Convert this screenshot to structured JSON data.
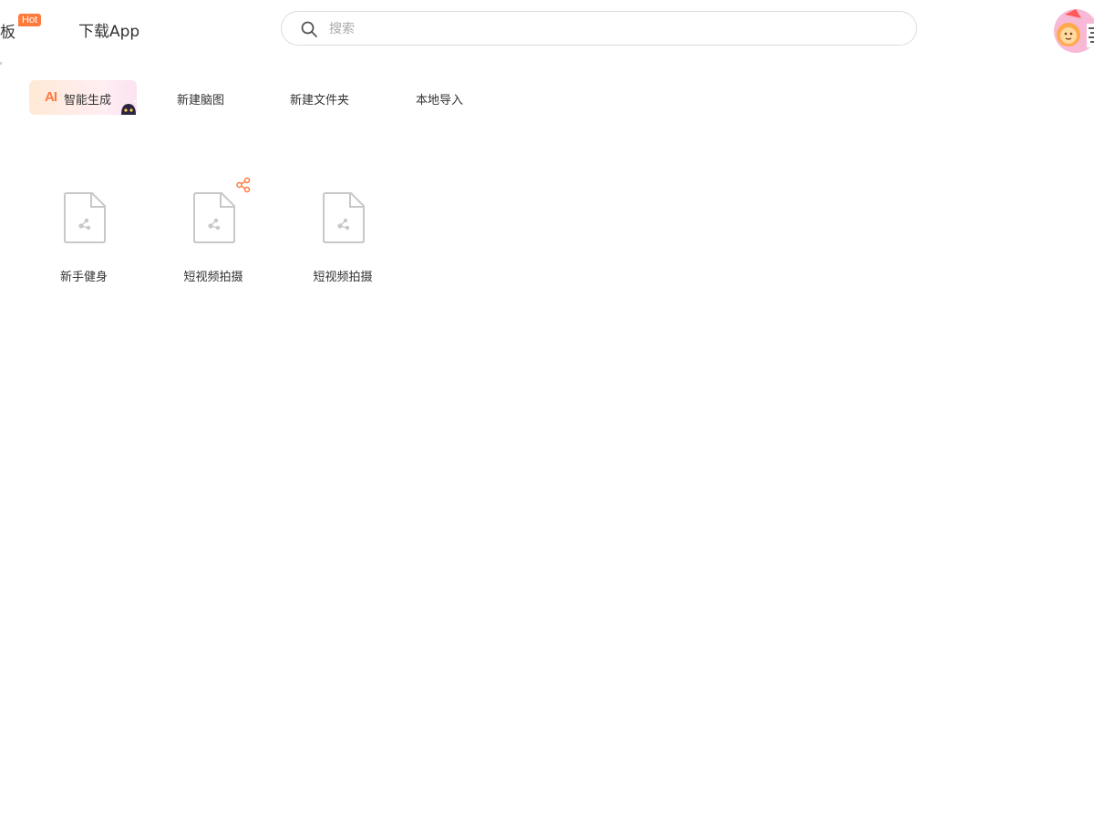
{
  "header": {
    "nav_templates_label": "板",
    "hot_badge": "Hot",
    "nav_download_label": "下载App",
    "search_placeholder": "搜索"
  },
  "toolbar": {
    "ai_mark": "AI",
    "ai_label": "智能生成",
    "new_mindmap_label": "新建脑图",
    "new_folder_label": "新建文件夹",
    "local_import_label": "本地导入"
  },
  "files": [
    {
      "name": "新手健身",
      "shared": false
    },
    {
      "name": "短视频拍摄",
      "shared": true
    },
    {
      "name": "短视频拍摄",
      "shared": false
    }
  ],
  "colors": {
    "accent": "#ff7a3d",
    "file_icon_stroke": "#c8c8c8"
  },
  "icons": {
    "search": "search-icon",
    "file": "mindmap-file-icon",
    "share": "share-icon"
  }
}
